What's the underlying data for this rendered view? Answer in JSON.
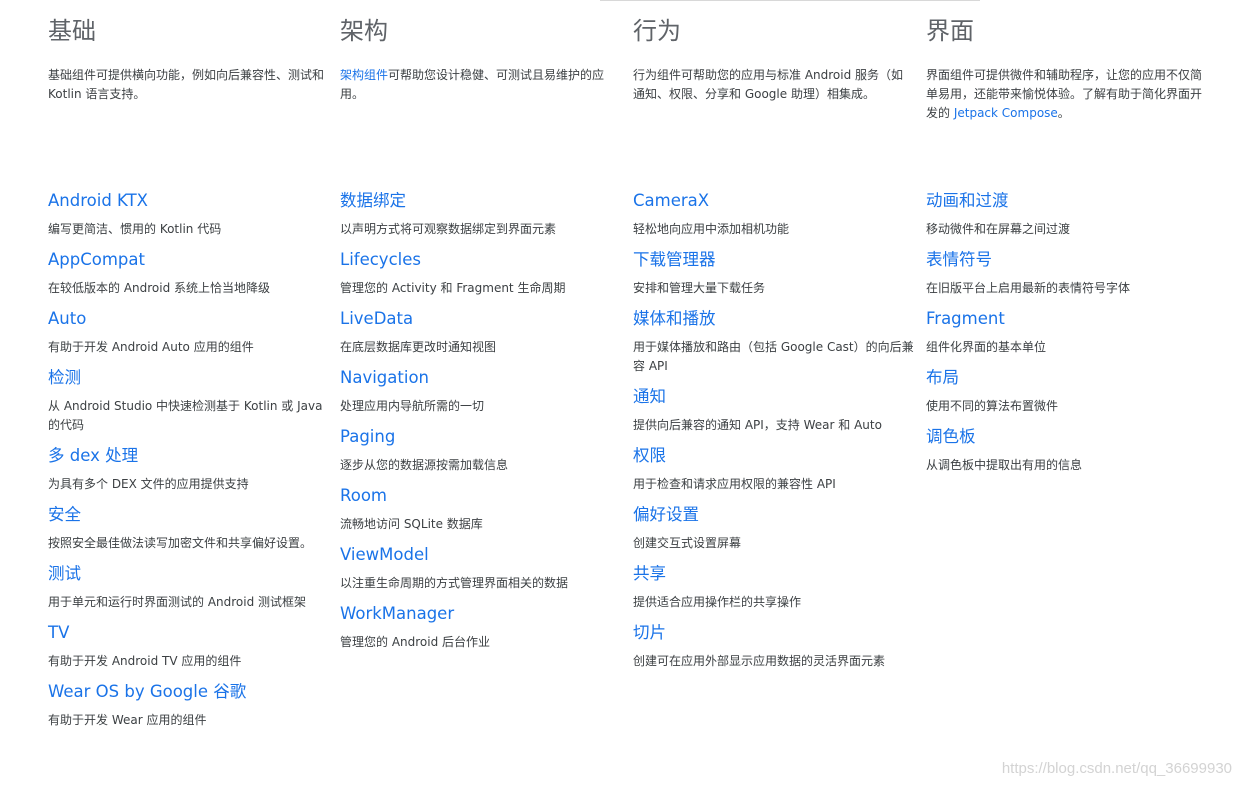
{
  "columns": [
    {
      "heading": "基础",
      "intro": {
        "link": "",
        "text": "基础组件可提供横向功能，例如向后兼容性、测试和 Kotlin 语言支持。",
        "link_tail": "",
        "tail": ""
      },
      "items": [
        {
          "title": "Android KTX",
          "desc": "编写更简洁、惯用的 Kotlin 代码"
        },
        {
          "title": "AppCompat",
          "desc": "在较低版本的 Android 系统上恰当地降级"
        },
        {
          "title": "Auto",
          "desc": "有助于开发 Android Auto 应用的组件"
        },
        {
          "title": "检测",
          "desc": "从 Android Studio 中快速检测基于 Kotlin 或 Java 的代码"
        },
        {
          "title": "多 dex 处理",
          "desc": "为具有多个 DEX 文件的应用提供支持"
        },
        {
          "title": "安全",
          "desc": "按照安全最佳做法读写加密文件和共享偏好设置。"
        },
        {
          "title": "测试",
          "desc": "用于单元和运行时界面测试的 Android 测试框架"
        },
        {
          "title": "TV",
          "desc": "有助于开发 Android TV 应用的组件"
        },
        {
          "title": "Wear OS by Google 谷歌",
          "desc": "有助于开发 Wear 应用的组件"
        }
      ]
    },
    {
      "heading": "架构",
      "intro": {
        "link": "架构组件",
        "text": "可帮助您设计稳健、可测试且易维护的应用。",
        "link_tail": "",
        "tail": ""
      },
      "items": [
        {
          "title": "数据绑定",
          "desc": "以声明方式将可观察数据绑定到界面元素"
        },
        {
          "title": "Lifecycles",
          "desc": "管理您的 Activity 和 Fragment 生命周期"
        },
        {
          "title": "LiveData",
          "desc": "在底层数据库更改时通知视图"
        },
        {
          "title": "Navigation",
          "desc": "处理应用内导航所需的一切"
        },
        {
          "title": "Paging",
          "desc": "逐步从您的数据源按需加载信息"
        },
        {
          "title": "Room",
          "desc": "流畅地访问 SQLite 数据库"
        },
        {
          "title": "ViewModel",
          "desc": "以注重生命周期的方式管理界面相关的数据"
        },
        {
          "title": "WorkManager",
          "desc": "管理您的 Android 后台作业"
        }
      ]
    },
    {
      "heading": "行为",
      "intro": {
        "link": "",
        "text": "行为组件可帮助您的应用与标准 Android 服务（如通知、权限、分享和 Google 助理）相集成。",
        "link_tail": "",
        "tail": ""
      },
      "items": [
        {
          "title": "CameraX",
          "desc": "轻松地向应用中添加相机功能"
        },
        {
          "title": "下载管理器",
          "desc": "安排和管理大量下载任务"
        },
        {
          "title": "媒体和播放",
          "desc": "用于媒体播放和路由（包括 Google Cast）的向后兼容 API"
        },
        {
          "title": "通知",
          "desc": "提供向后兼容的通知 API，支持 Wear 和 Auto"
        },
        {
          "title": "权限",
          "desc": "用于检查和请求应用权限的兼容性 API"
        },
        {
          "title": "偏好设置",
          "desc": "创建交互式设置屏幕"
        },
        {
          "title": "共享",
          "desc": "提供适合应用操作栏的共享操作"
        },
        {
          "title": "切片",
          "desc": "创建可在应用外部显示应用数据的灵活界面元素"
        }
      ]
    },
    {
      "heading": "界面",
      "intro": {
        "link": "",
        "text": "界面组件可提供微件和辅助程序，让您的应用不仅简单易用，还能带来愉悦体验。了解有助于简化界面开发的 ",
        "link_tail": "Jetpack Compose",
        "tail": "。"
      },
      "items": [
        {
          "title": "动画和过渡",
          "desc": "移动微件和在屏幕之间过渡"
        },
        {
          "title": "表情符号",
          "desc": "在旧版平台上启用最新的表情符号字体"
        },
        {
          "title": "Fragment",
          "desc": "组件化界面的基本单位"
        },
        {
          "title": "布局",
          "desc": "使用不同的算法布置微件"
        },
        {
          "title": "调色板",
          "desc": "从调色板中提取出有用的信息"
        }
      ]
    }
  ],
  "watermark": "https://blog.csdn.net/qq_36699930"
}
